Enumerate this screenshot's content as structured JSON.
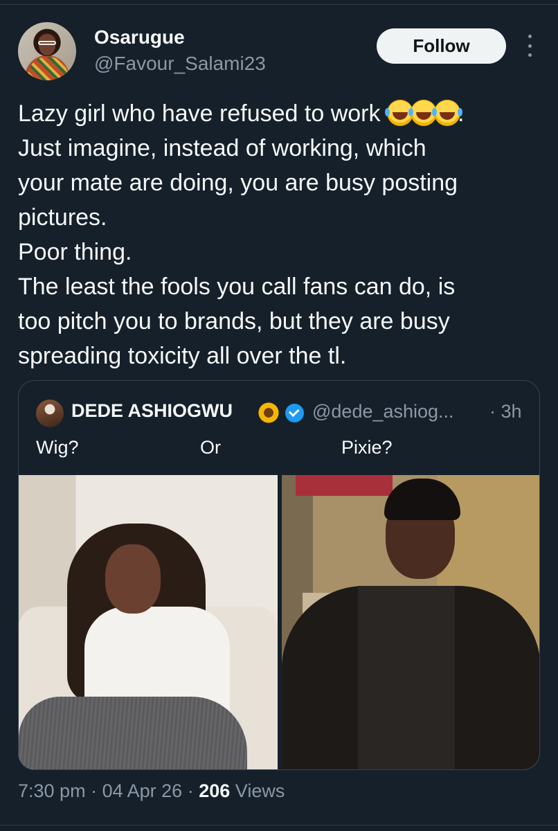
{
  "author": {
    "display_name": "Osarugue",
    "handle": "@Favour_Salami23",
    "avatar_icon": "profile-photo"
  },
  "actions": {
    "follow_label": "Follow",
    "more_icon": "vertical-ellipsis-icon"
  },
  "tweet": {
    "line1": "Lazy girl who have refused to work",
    "line1_emojis": [
      "face-with-tears-of-joy",
      "face-with-tears-of-joy",
      "face-with-tears-of-joy"
    ],
    "line1_end": ".",
    "rest": "Just imagine, instead of working, which\nyour mate are doing, you are busy posting\npictures.\nPoor thing.\nThe least the fools you call fans can do, is\ntoo pitch you to brands, but they are busy\nspreading toxicity all over the tl."
  },
  "quote": {
    "display_name": "DEDE ASHIOGWU",
    "name_emoji": "sunflower",
    "verified_icon": "verified-badge-icon",
    "handle": "@dede_ashiog...",
    "time": "· 3h",
    "text_parts": [
      "Wig?",
      "Or",
      "Pixie?"
    ],
    "images": [
      "woman-in-white-shirt-photo",
      "woman-in-leather-jacket-photo"
    ]
  },
  "meta": {
    "time": "7:30 pm",
    "sep1": "·",
    "date": "04 Apr 26",
    "sep2": "·",
    "views_count": "206",
    "views_label": "Views"
  },
  "colors": {
    "background": "#15202b",
    "text": "#f7f9f9",
    "muted": "#8b98a5",
    "border": "#38444d",
    "verified": "#1d9bf0",
    "button_bg": "#eff3f4"
  }
}
